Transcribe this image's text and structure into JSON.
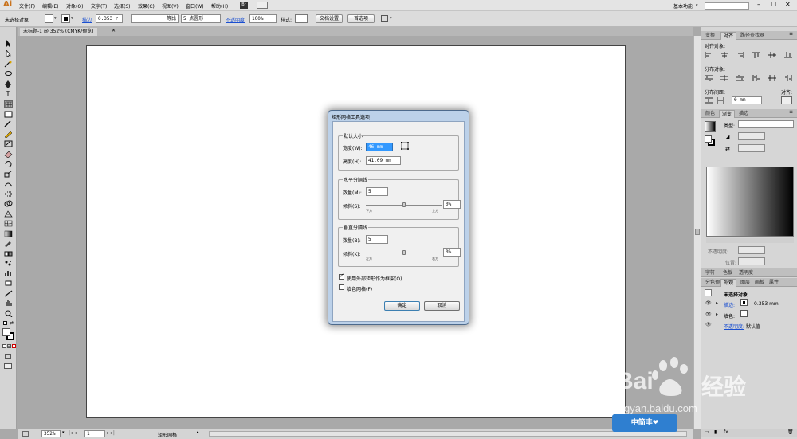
{
  "app": {
    "logo": "Ai",
    "workspace": "基本功能",
    "search_placeholder": ""
  },
  "menu": [
    "文件(F)",
    "编辑(E)",
    "对象(O)",
    "文字(T)",
    "选择(S)",
    "效果(C)",
    "视图(V)",
    "窗口(W)",
    "帮助(H)"
  ],
  "menu_badge": "Br",
  "control": {
    "no_selection": "未选择对象",
    "stroke_label": "描边",
    "stroke_value": "0.353 r",
    "stroke_style": "等比",
    "brush": "5 点圆形",
    "opacity_label": "不透明度",
    "opacity_value": "100%",
    "style_label": "样式:",
    "doc_setup": "文档设置",
    "preferences": "首选项"
  },
  "document": {
    "tab": "未标题-1 @ 352% (CMYK/预览)"
  },
  "status": {
    "zoom": "352%",
    "page": "1",
    "tool_name": "矩形网格"
  },
  "dialog": {
    "title": "矩形网格工具选项",
    "size_group": "默认大小",
    "width_label": "宽度(W):",
    "width_value": "46 mm",
    "height_label": "高度(H):",
    "height_value": "41.09 mm",
    "hdiv_group": "水平分隔线",
    "hdiv_count_label": "数量(M):",
    "hdiv_count": "5",
    "hdiv_skew_label": "倾斜(S):",
    "hdiv_skew": "0%",
    "hdiv_left": "下方",
    "hdiv_right": "上方",
    "vdiv_group": "垂直分隔线",
    "vdiv_count_label": "数量(B):",
    "vdiv_count": "5",
    "vdiv_skew_label": "倾斜(K):",
    "vdiv_skew": "0%",
    "vdiv_left": "左方",
    "vdiv_right": "右方",
    "use_outer_label": "使用外部矩形作为框架(O)",
    "fill_grid_label": "填色网格(F)",
    "use_outer_checked": true,
    "fill_grid_checked": false,
    "ok": "确定",
    "cancel": "取消"
  },
  "panels": {
    "top_tabs": [
      "变换",
      "对齐",
      "路径查找器"
    ],
    "align_objects": "对齐对象:",
    "distribute_objects": "分布对象:",
    "distribute_spacing": "分布间距:",
    "align_to": "对齐:",
    "spacing_value": "0 mm",
    "gradient_tabs": [
      "颜色",
      "渐变",
      "描边"
    ],
    "type_label": "类型:",
    "opacity_label": "不透明度:",
    "position_label": "位置:",
    "lower_tabs": [
      "字符",
      "色板",
      "透明度"
    ],
    "appearance_tabs": [
      "外观",
      "图层",
      "画板",
      "属性"
    ],
    "appearance_first_tab": "分色预览",
    "appearance": {
      "title": "未选择对象",
      "stroke_label": "描边:",
      "stroke_value": "0.353 mm",
      "fill_label": "填色:",
      "opacity_label": "不透明度:",
      "opacity_value": "默认值"
    }
  },
  "watermark": {
    "brand": "Bai",
    "brand2": "经验",
    "url": "jingyan.baidu.com",
    "badge": "中简丰❤"
  },
  "colors": {
    "dialog_frame": "#bcd1e9",
    "link_blue": "#1a4fd0",
    "selection": "#3399ff"
  }
}
